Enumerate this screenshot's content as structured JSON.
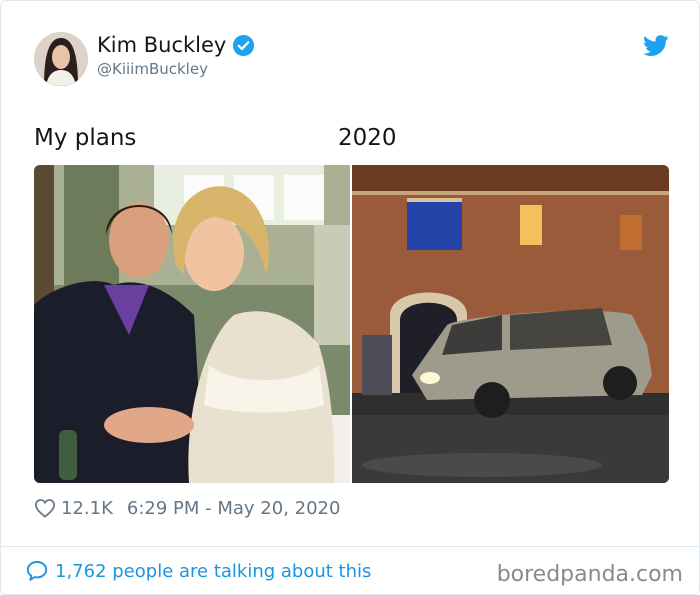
{
  "user": {
    "display_name": "Kim Buckley",
    "handle": "@KiiimBuckley",
    "verified": true
  },
  "tweet": {
    "text_left": "My plans",
    "text_right": "2020",
    "likes": "12.1K",
    "timestamp": "6:29 PM - May 20, 2020"
  },
  "media": {
    "left_image": "wedding-couple-photo",
    "right_image": "car-flying-night-photo"
  },
  "footer": {
    "talking": "1,762 people are talking about this",
    "watermark": "boredpanda.com"
  },
  "colors": {
    "twitter_blue": "#1da1f2",
    "link_blue": "#1b95e0",
    "muted_text": "#657786",
    "primary_text": "#14171a"
  },
  "icons": [
    "verified-badge-icon",
    "twitter-bird-icon",
    "heart-icon",
    "comment-bubble-icon"
  ]
}
